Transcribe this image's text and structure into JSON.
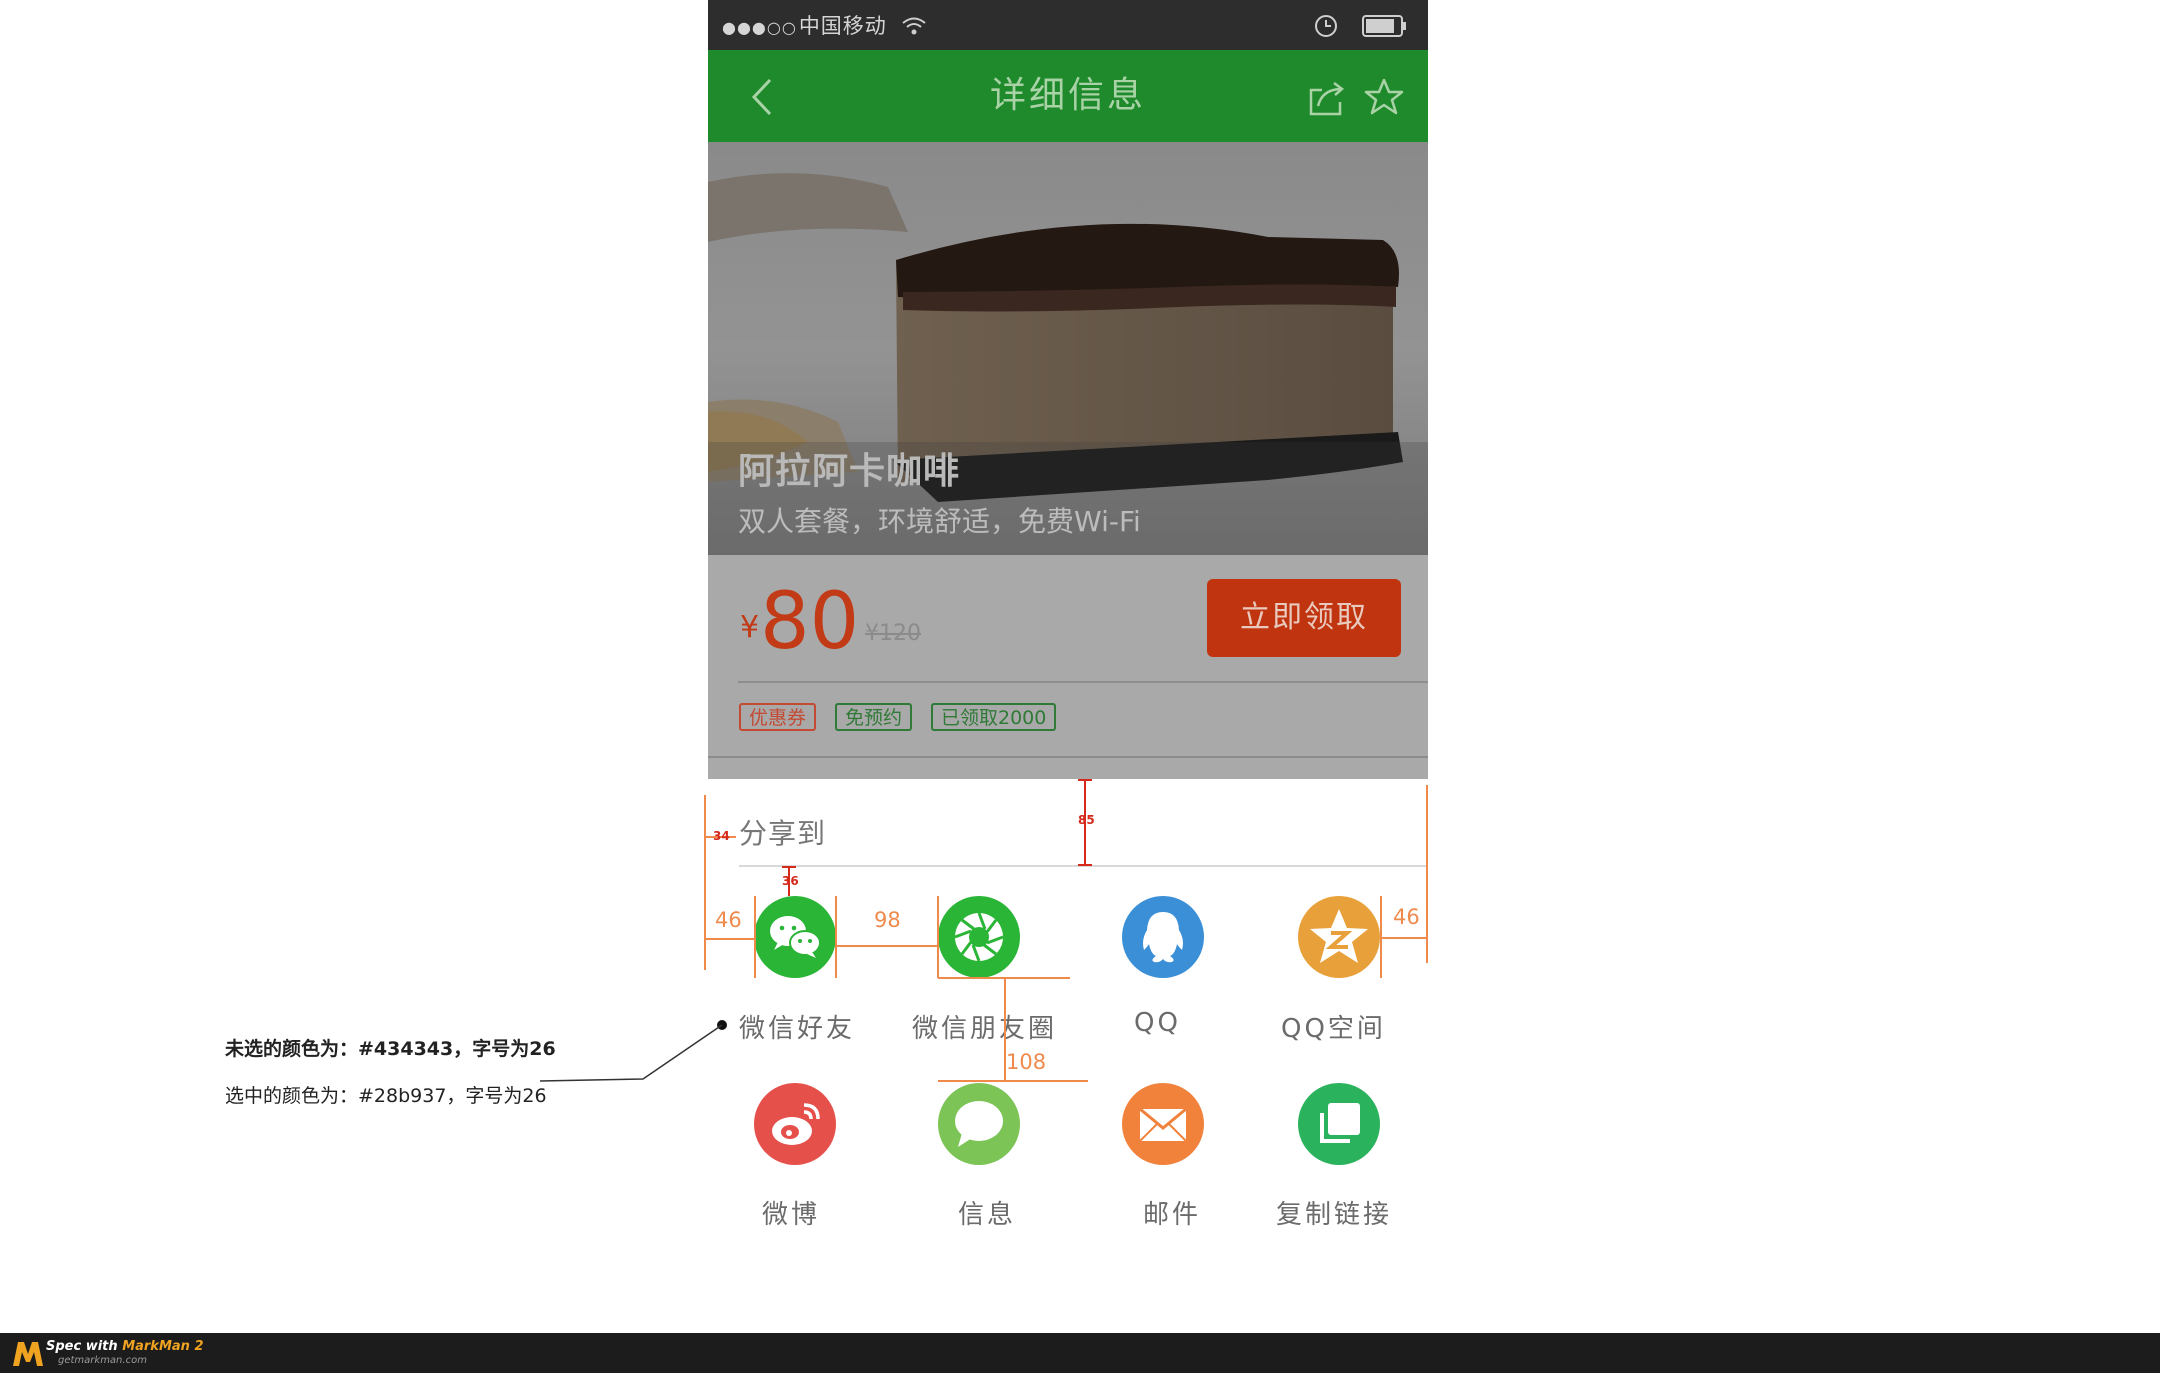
{
  "status_bar": {
    "signal": "●●●○○",
    "carrier": "中国移动"
  },
  "nav": {
    "title": "详细信息"
  },
  "hero": {
    "title": "阿拉阿卡咖啡",
    "subtitle": "双人套餐，环境舒适，免费Wi-Fi"
  },
  "price": {
    "currency": "¥",
    "value": "80",
    "original": "¥120",
    "claim_button": "立即领取"
  },
  "tags": [
    "优惠券",
    "免预约",
    "已领取2000"
  ],
  "share": {
    "title": "分享到",
    "items": [
      {
        "label": "微信好友",
        "icon": "wechat-icon",
        "color": "#2bb537"
      },
      {
        "label": "微信朋友圈",
        "icon": "moments-icon",
        "color": "#2bb537"
      },
      {
        "label": "QQ",
        "icon": "qq-icon",
        "color": "#3b8fd6"
      },
      {
        "label": "QQ空间",
        "icon": "qzone-icon",
        "color": "#e8a13a"
      },
      {
        "label": "微博",
        "icon": "weibo-icon",
        "color": "#e5504b"
      },
      {
        "label": "信息",
        "icon": "message-icon",
        "color": "#7dc456"
      },
      {
        "label": "邮件",
        "icon": "mail-icon",
        "color": "#f0823c"
      },
      {
        "label": "复制链接",
        "icon": "copy-link-icon",
        "color": "#2ab25c"
      }
    ]
  },
  "annotations": {
    "m34": "34",
    "m85": "85",
    "m36": "36",
    "m46_left": "46",
    "m98": "98",
    "m46_right": "46",
    "m108": "108",
    "note_unselected": "未选的颜色为：#434343，字号为26",
    "note_selected": "选中的颜色为：#28b937，字号为26"
  },
  "footer": {
    "brand_prefix": "Spec with ",
    "brand_name": "MarkMan 2",
    "url": "getmarkman.com"
  }
}
